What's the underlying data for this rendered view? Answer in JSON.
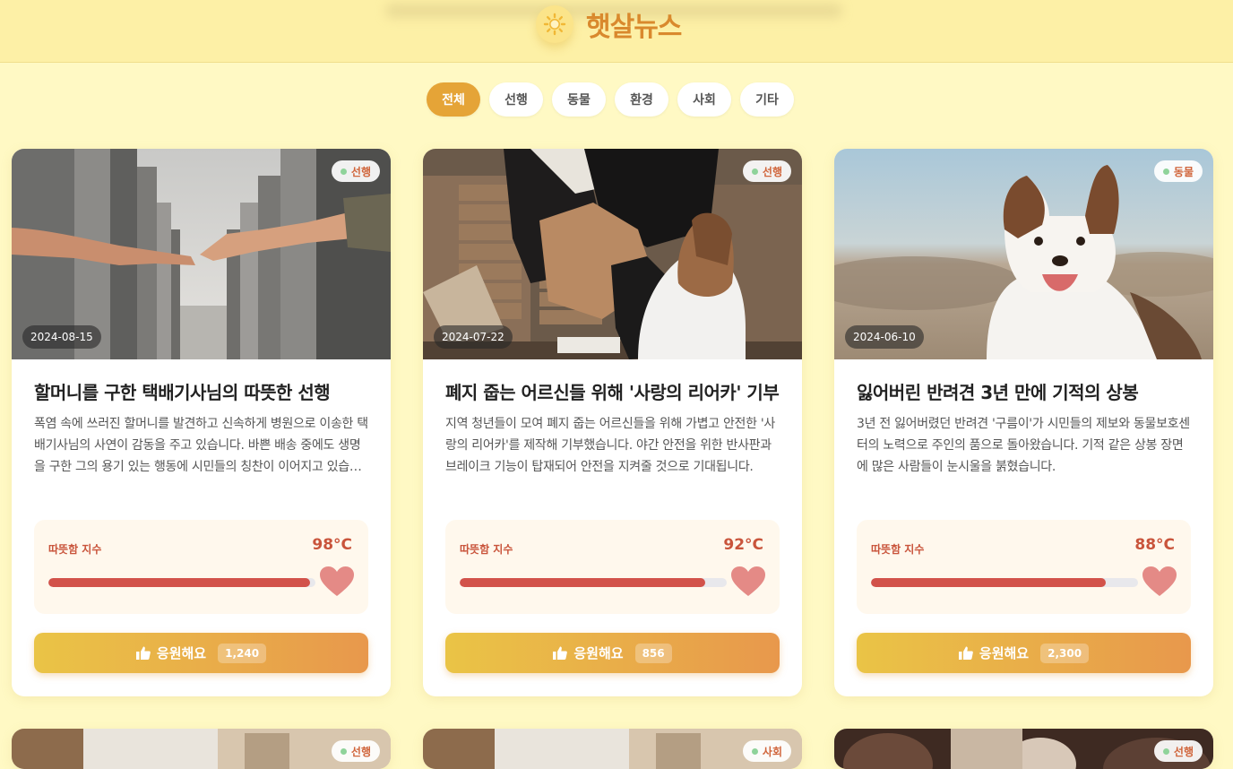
{
  "header": {
    "title": "햇살뉴스",
    "icon": "sun-icon"
  },
  "filters": [
    {
      "label": "전체",
      "active": true
    },
    {
      "label": "선행",
      "active": false
    },
    {
      "label": "동물",
      "active": false
    },
    {
      "label": "환경",
      "active": false
    },
    {
      "label": "사회",
      "active": false
    },
    {
      "label": "기타",
      "active": false
    }
  ],
  "cards": [
    {
      "category": "선행",
      "date": "2024-08-15",
      "title": "할머니를 구한 택배기사님의 따뜻한 선행",
      "description": "폭염 속에 쓰러진 할머니를 발견하고 신속하게 병원으로 이송한 택배기사님의 사연이 감동을 주고 있습니다. 바쁜 배송 중에도 생명을 구한 그의 용기 있는 행동에 시민들의 칭찬이 이어지고 있습니다.",
      "warmth_label": "따뜻함 지수",
      "warmth_value": "98°C",
      "warmth_percent": 98,
      "cheer_label": "응원해요",
      "cheer_count": "1,240"
    },
    {
      "category": "선행",
      "date": "2024-07-22",
      "title": "폐지 줍는 어르신들 위해 '사랑의 리어카' 기부",
      "description": "지역 청년들이 모여 폐지 줍는 어르신들을 위해 가볍고 안전한 '사랑의 리어카'를 제작해 기부했습니다. 야간 안전을 위한 반사판과 브레이크 기능이 탑재되어 안전을 지켜줄 것으로 기대됩니다.",
      "warmth_label": "따뜻함 지수",
      "warmth_value": "92°C",
      "warmth_percent": 92,
      "cheer_label": "응원해요",
      "cheer_count": "856"
    },
    {
      "category": "동물",
      "date": "2024-06-10",
      "title": "잃어버린 반려견 3년 만에 기적의 상봉",
      "description": "3년 전 잃어버렸던 반려견 '구름이'가 시민들의 제보와 동물보호센터의 노력으로 주인의 품으로 돌아왔습니다. 기적 같은 상봉 장면에 많은 사람들이 눈시울을 붉혔습니다.",
      "warmth_label": "따뜻함 지수",
      "warmth_value": "88°C",
      "warmth_percent": 88,
      "cheer_label": "응원해요",
      "cheer_count": "2,300"
    }
  ],
  "next_row": [
    {
      "category": "선행"
    },
    {
      "category": "사회"
    },
    {
      "category": "선행"
    }
  ],
  "colors": {
    "accent": "#e5a437",
    "warm": "#d2524a",
    "background": "#fff9c4"
  }
}
